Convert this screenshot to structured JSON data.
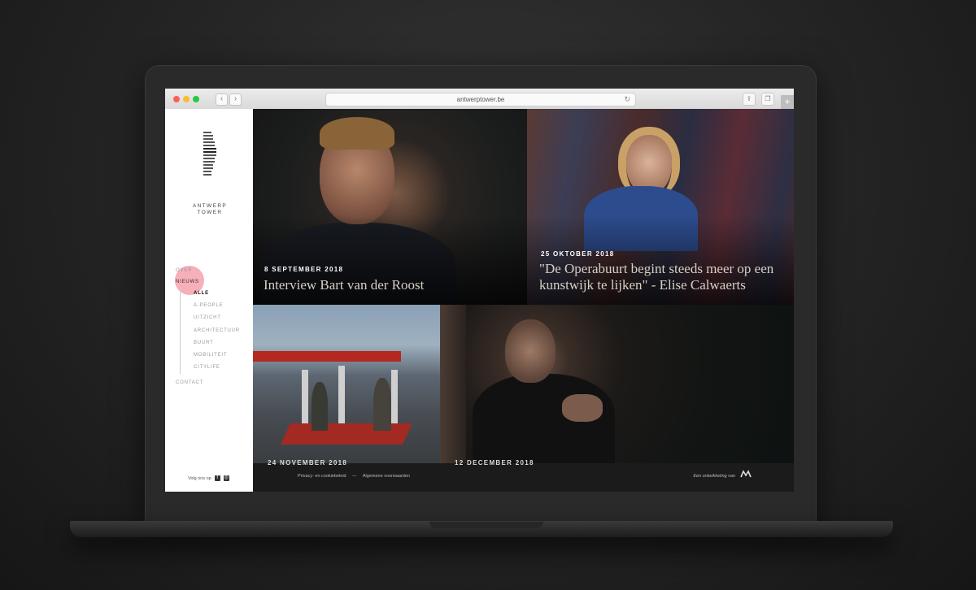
{
  "browser": {
    "url": "antwerptower.be",
    "back": "‹",
    "forward": "›",
    "reload": "↻",
    "new_tab": "+"
  },
  "sidebar": {
    "logo_text": "ANTWERP TOWER",
    "menu": [
      {
        "label": "OVER"
      },
      {
        "label": "NIEUWS"
      }
    ],
    "submenu": [
      "ALLE",
      "A-PEOPLE",
      "UITZICHT",
      "ARCHITECTUUR",
      "BUURT",
      "MOBILITEIT",
      "CITYLIFE"
    ],
    "contact": "CONTACT",
    "follow_label": "Volg ons op",
    "social": [
      "f",
      "◎"
    ]
  },
  "articles": [
    {
      "date": "8 SEPTEMBER 2018",
      "title": "Interview Bart van der Roost"
    },
    {
      "date": "25 OKTOBER 2018",
      "title": "\"De Operabuurt begint steeds meer op een kunstwijk te lijken\" - Elise Calwaerts"
    },
    {
      "date": "24 NOVEMBER 2018",
      "title": ""
    },
    {
      "date": "12 DECEMBER 2018",
      "title": ""
    }
  ],
  "footer": {
    "privacy": "Privacy- en cookiebeleid",
    "separator": "—",
    "terms": "Algemene voorwaarden",
    "developer": "Een ontwikkeling van"
  },
  "colors": {
    "accent_pink": "#f06e82",
    "footer_bg": "#1b1b1b"
  }
}
